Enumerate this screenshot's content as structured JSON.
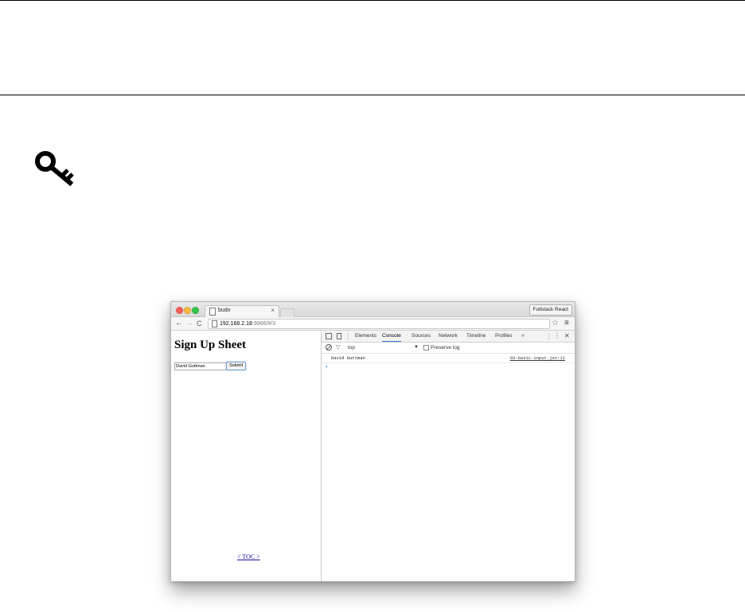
{
  "browser": {
    "tab_title": "budo",
    "tab_close": "×",
    "profile_label": "Fullstack React",
    "nav": {
      "back": "←",
      "forward": "→",
      "reload": "C"
    },
    "url_host": "192.168.2.18",
    "url_rest": ":9966/#/3",
    "bookmark_icon": "☆",
    "menu_icon": "≡"
  },
  "page": {
    "heading": "Sign Up Sheet",
    "name_value": "David Guttman",
    "submit_label": "Submit",
    "toc_link": "< TOC >"
  },
  "devtools": {
    "tabs": [
      "Elements",
      "Console",
      "Sources",
      "Network",
      "Timeline",
      "Profiles"
    ],
    "active_tab": "Console",
    "more": "»",
    "kebab": "⋮",
    "close": "✕",
    "context": "top",
    "context_arrow": "▼",
    "preserve_log_label": "Preserve log",
    "log": {
      "message": "David Guttman",
      "source": "03-basic-input.jsx:11"
    },
    "prompt": "›"
  },
  "colors": {
    "close_light": "#fc605b",
    "minimize_light": "#fdbc40",
    "zoom_light": "#34c84a",
    "active_tab_underline": "#3879d9",
    "link": "#1a0dab"
  },
  "icons": [
    "key-icon",
    "page-icon",
    "star-icon",
    "menu-icon",
    "inspect-icon",
    "device-icon",
    "clear-console-icon",
    "filter-icon"
  ]
}
